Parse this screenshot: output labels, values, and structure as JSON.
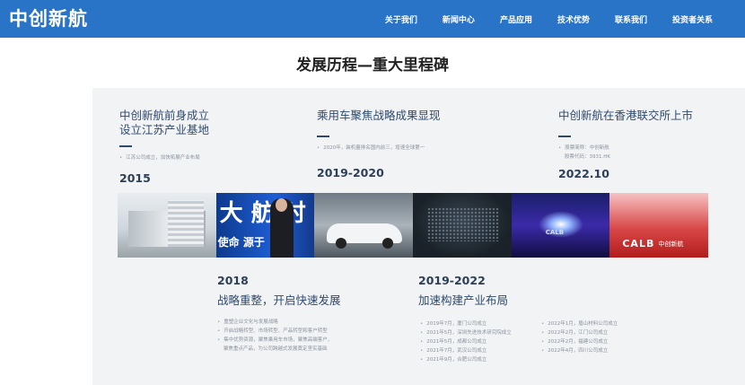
{
  "header": {
    "logo": "中创新航",
    "nav": [
      "关于我们",
      "新闻中心",
      "产品应用",
      "技术优势",
      "联系我们",
      "投资者关系"
    ]
  },
  "section_title": "发展历程—重大里程碑",
  "milestones": {
    "m2015": {
      "title_line1": "中创新航前身成立",
      "title_line2": "设立江苏产业基地",
      "items": [
        "江苏公司成立，加快拓展产业布局"
      ],
      "year": "2015"
    },
    "m2019_2020": {
      "title": "乘用车聚焦战略成果显现",
      "items": [
        "2020年，装机量排名国内前三，增速全球第一"
      ],
      "year": "2019-2020"
    },
    "m2022_10": {
      "title": "中创新航在香港联交所上市",
      "items": [
        "股票简称：中创新航",
        "股票代码：3931.HK"
      ],
      "year": "2022.10"
    },
    "m2018": {
      "year": "2018",
      "title": "战略重整，开启快速发展",
      "items": [
        "重塑企业文化与发展战略",
        "开启战略转型、市场转型、产品转型和客户转型",
        "集中优势资源，聚焦乘用车市场，聚焦高端客户，",
        "聚焦重点产品，为公司跨越式发展奠定坚实基础"
      ]
    },
    "m2019_2022": {
      "year": "2019-2022",
      "title": "加速构建产业布局",
      "items_left": [
        "2019年7月，厦门公司成立",
        "2021年5月，深圳先进技术研究院成立",
        "2021年5月，成都公司成立",
        "2021年7月，武汉公司成立",
        "2021年9月，合肥公司成立"
      ],
      "items_right": [
        "2022年1月，眉山材料公司成立",
        "2022年2月，江门公司成立",
        "2022年2月，福建公司成立",
        "2022年4月，四川公司成立"
      ]
    }
  },
  "photos": {
    "p2_big": "大 舫 时",
    "p2_small": "使命 源于",
    "p5_label": "CALB",
    "p6_label": "CALB",
    "p6_label2": "中创新航"
  }
}
